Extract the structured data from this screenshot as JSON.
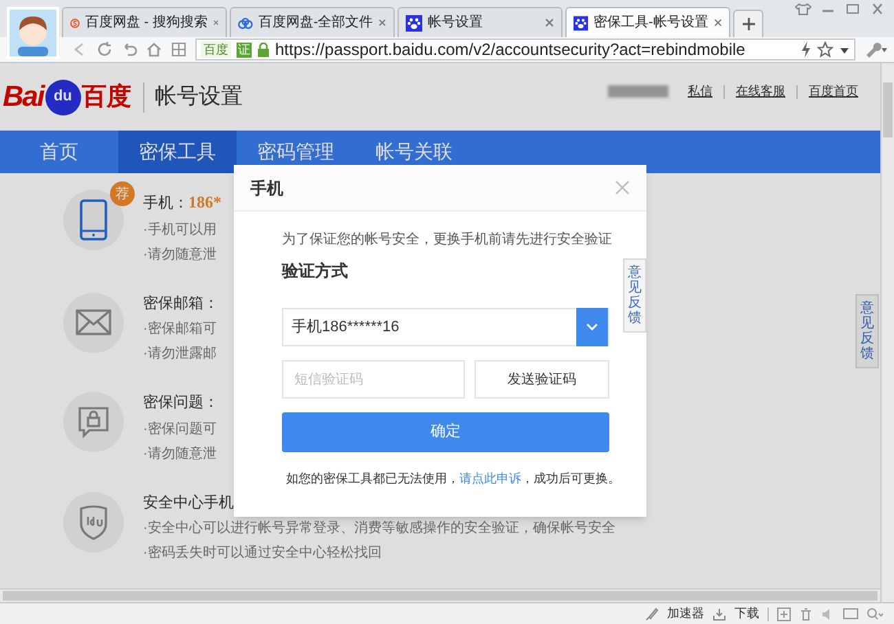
{
  "browser": {
    "tabs": [
      {
        "label": "百度网盘 - 搜狗搜索",
        "kind": "sogou",
        "selected": false
      },
      {
        "label": "百度网盘-全部文件",
        "kind": "cloud",
        "selected": false
      },
      {
        "label": "帐号设置",
        "kind": "paw",
        "selected": false
      },
      {
        "label": "密保工具-帐号设置",
        "kind": "paw",
        "selected": true
      }
    ],
    "site_badge": "百度",
    "verify_badge": "证",
    "url": "https://passport.baidu.com/v2/accountsecurity?act=rebindmobile"
  },
  "header": {
    "logo": {
      "left": "Bai",
      "paw": "du",
      "right": "百度"
    },
    "title": "帐号设置",
    "links": [
      "私信",
      "在线客服",
      "百度首页"
    ]
  },
  "nav": [
    {
      "label": "首页",
      "selected": false
    },
    {
      "label": "密保工具",
      "selected": true
    },
    {
      "label": "密码管理",
      "selected": false
    },
    {
      "label": "帐号关联",
      "selected": false
    }
  ],
  "security_items": [
    {
      "kind": "phone",
      "badge": "荐",
      "title": "手机：",
      "value": "186*",
      "lines": [
        "·手机可以用",
        "·请勿随意泄"
      ]
    },
    {
      "kind": "mail",
      "title": "密保邮箱：",
      "lines": [
        "·密保邮箱可",
        "·请勿泄露邮"
      ]
    },
    {
      "kind": "lock",
      "title": "密保问题：",
      "lines": [
        "·密保问题可",
        "·请勿随意泄"
      ]
    },
    {
      "kind": "shield",
      "title": "安全中心手机",
      "lines": [
        "·安全中心可以进行帐号异常登录、消费等敏感操作的安全验证，确保帐号安全",
        "·密码丢失时可以通过安全中心轻松找回"
      ]
    }
  ],
  "feedback": [
    "意见反馈",
    "意见反馈"
  ],
  "dialog": {
    "title": "手机",
    "description": "为了保证您的帐号安全，更换手机前请先进行安全验证",
    "section": "验证方式",
    "method": "手机186******16",
    "code_placeholder": "短信验证码",
    "send_button": "发送验证码",
    "confirm_button": "确定",
    "note_before": "如您的密保工具都已无法使用，",
    "note_link": "请点此申诉",
    "note_after": "，成功后可更换。"
  },
  "status_bar": {
    "accelerator": "加速器",
    "download": "下载"
  }
}
